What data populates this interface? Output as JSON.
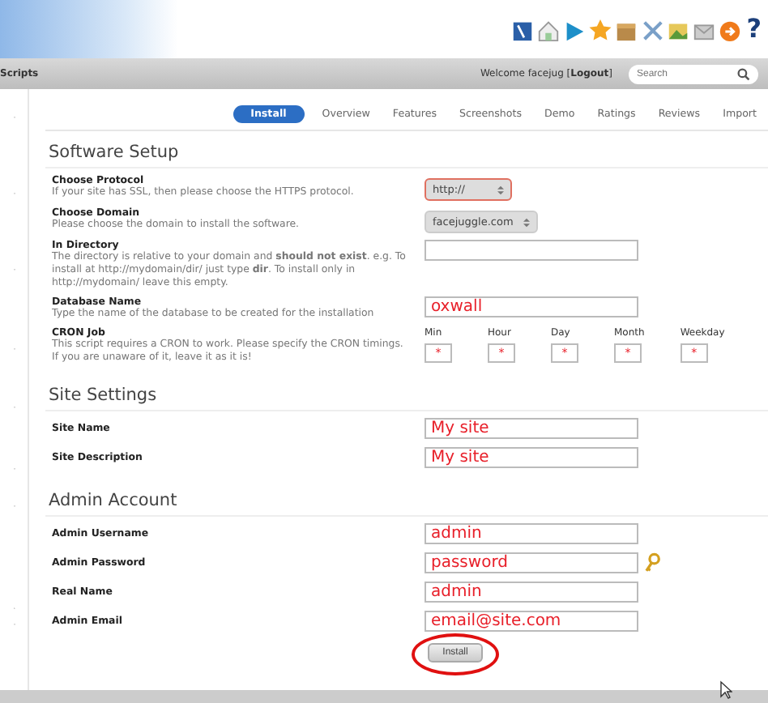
{
  "header": {
    "help": "?"
  },
  "nav_bar": {
    "section": "Scripts",
    "welcome": "Welcome facejug [**Logout**]",
    "search": {
      "placeholder": "Search"
    }
  },
  "tabs": [
    {
      "label": "Install",
      "selected": true
    },
    {
      "label": "Overview",
      "selected": false
    },
    {
      "label": "Features",
      "selected": false
    },
    {
      "label": "Screenshots",
      "selected": false
    },
    {
      "label": "Demo",
      "selected": false
    },
    {
      "label": "Ratings",
      "selected": false
    },
    {
      "label": "Reviews",
      "selected": false
    },
    {
      "label": "Import",
      "selected": false
    }
  ],
  "sections": [
    {
      "title": "Software Setup",
      "fields": [
        {
          "kind": "select",
          "label": "Choose Protocol",
          "description": "If your site has SSL, then please choose the HTTPS protocol.",
          "value": "http://",
          "focused": true
        },
        {
          "kind": "select",
          "label": "Choose Domain",
          "description": "Please choose the domain to install the software.",
          "value": "facejuggle.com",
          "focused": false
        },
        {
          "kind": "text",
          "label": "In Directory",
          "description": "The directory is relative to your domain and **should not exist**. e.g. To install at http://mydomain/dir/ just type **dir**. To install only in http://mydomain/ leave this empty."
        },
        {
          "kind": "text",
          "label": "Database Name",
          "description": "Type the name of the database to be created for the installation",
          "value": "oxwall"
        },
        {
          "kind": "cron",
          "label": "CRON Job",
          "description": "This script requires a CRON to work. Please specify the CRON timings. If you are unaware of it, leave it as it is!",
          "columns": [
            {
              "label": "Min",
              "value": "*"
            },
            {
              "label": "Hour",
              "value": "*"
            },
            {
              "label": "Day",
              "value": "*"
            },
            {
              "label": "Month",
              "value": "*"
            },
            {
              "label": "Weekday",
              "value": "*"
            }
          ]
        }
      ]
    },
    {
      "title": "Site Settings",
      "fields": [
        {
          "kind": "text",
          "label": "Site Name",
          "value": "My site"
        },
        {
          "kind": "text",
          "label": "Site Description",
          "value": "My site"
        }
      ]
    },
    {
      "title": "Admin Account",
      "fields": [
        {
          "kind": "text",
          "label": "Admin Username",
          "value": "admin"
        },
        {
          "kind": "password",
          "label": "Admin Password",
          "value": "password"
        },
        {
          "kind": "text",
          "label": "Real Name",
          "value": "admin"
        },
        {
          "kind": "text",
          "label": "Admin Email",
          "value": "email@site.com"
        }
      ]
    }
  ],
  "install_button": "Install"
}
